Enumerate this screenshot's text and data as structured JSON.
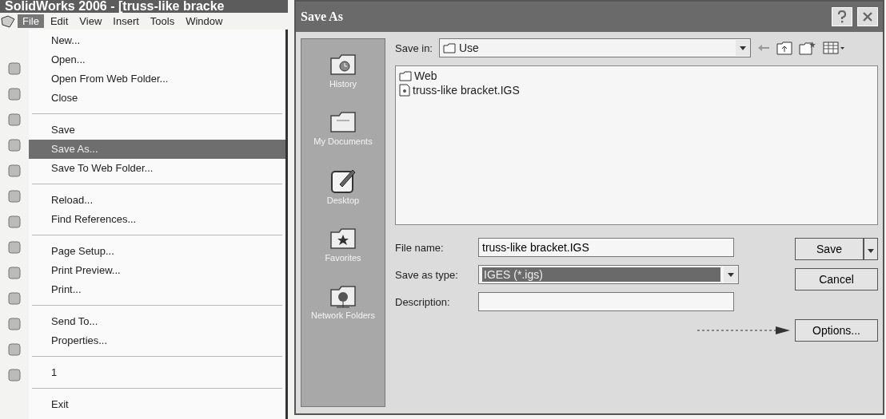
{
  "app_window": {
    "title": "SolidWorks 2006 - [truss-like bracke",
    "menubar": [
      {
        "label": "File",
        "selected": true
      },
      {
        "label": "Edit",
        "selected": false
      },
      {
        "label": "View",
        "selected": false
      },
      {
        "label": "Insert",
        "selected": false
      },
      {
        "label": "Tools",
        "selected": false
      },
      {
        "label": "Window",
        "selected": false
      }
    ],
    "file_menu": [
      [
        {
          "label": "New...",
          "selected": false
        },
        {
          "label": "Open...",
          "selected": false
        },
        {
          "label": "Open From Web Folder...",
          "selected": false
        },
        {
          "label": "Close",
          "selected": false
        }
      ],
      [
        {
          "label": "Save",
          "selected": false
        },
        {
          "label": "Save As...",
          "selected": true
        },
        {
          "label": "Save To Web Folder...",
          "selected": false
        }
      ],
      [
        {
          "label": "Reload...",
          "selected": false
        },
        {
          "label": "Find References...",
          "selected": false
        }
      ],
      [
        {
          "label": "Page Setup...",
          "selected": false
        },
        {
          "label": "Print Preview...",
          "selected": false
        },
        {
          "label": "Print...",
          "selected": false
        }
      ],
      [
        {
          "label": "Send To...",
          "selected": false
        },
        {
          "label": "Properties...",
          "selected": false
        }
      ],
      [
        {
          "label": "1",
          "selected": false
        }
      ],
      [
        {
          "label": "Exit",
          "selected": false
        }
      ]
    ]
  },
  "dialog": {
    "title": "Save As",
    "places": [
      {
        "label": "History",
        "kind": "history"
      },
      {
        "label": "My Documents",
        "kind": "documents"
      },
      {
        "label": "Desktop",
        "kind": "desktop"
      },
      {
        "label": "Favorites",
        "kind": "favorites"
      },
      {
        "label": "Network Folders",
        "kind": "network"
      }
    ],
    "save_in": {
      "label": "Save in:",
      "value": "Use"
    },
    "files": [
      {
        "name": "Web",
        "kind": "folder"
      },
      {
        "name": "truss-like bracket.IGS",
        "kind": "file"
      }
    ],
    "file_name": {
      "label": "File name:",
      "value": "truss-like bracket.IGS"
    },
    "save_as_type": {
      "label": "Save as type:",
      "value": "IGES (*.igs)"
    },
    "description": {
      "label": "Description:"
    },
    "buttons": {
      "save": "Save",
      "cancel": "Cancel",
      "options": "Options..."
    }
  }
}
